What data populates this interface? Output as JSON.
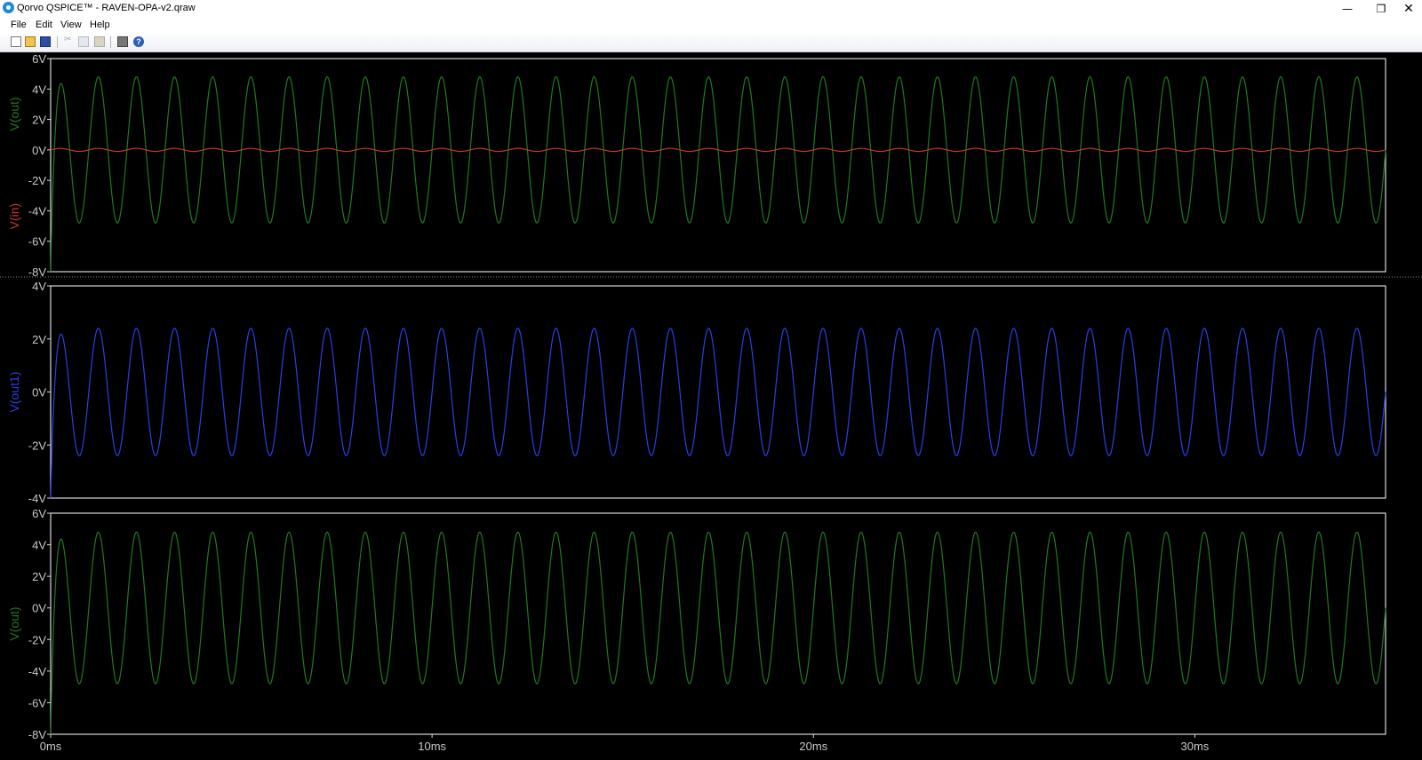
{
  "window": {
    "title": "Qorvo QSPICE™ - RAVEN-OPA-v2.qraw",
    "controls": {
      "minimize": "—",
      "maximize": "❐",
      "close": "✕"
    }
  },
  "menu": {
    "items": [
      "File",
      "Edit",
      "View",
      "Help"
    ]
  },
  "toolbar": {
    "icons": [
      "new-file-icon",
      "open-folder-icon",
      "save-icon",
      "cut-icon",
      "copy-icon",
      "paste-icon",
      "print-icon",
      "help-icon"
    ],
    "help_glyph": "?",
    "cut_glyph": "✂"
  },
  "colors": {
    "background": "#000000",
    "frame": "#d8d8d8",
    "axis_text": "#c8c8c8",
    "v_out": "#1f7a1f",
    "v_in": "#c0392b",
    "v_out1": "#2a3fe6"
  },
  "chart_data": [
    {
      "type": "line",
      "title": "",
      "xlim": [
        0,
        35
      ],
      "ylim": [
        -8,
        6
      ],
      "yticks": [
        "6V",
        "4V",
        "2V",
        "0V",
        "-2V",
        "-4V",
        "-6V",
        "-8V"
      ],
      "ylabels": [
        "V(out)",
        "V(in)"
      ],
      "series": [
        {
          "name": "V(out)",
          "color": "#1f7a1f",
          "amplitude": 4.8,
          "frequency_khz": 1,
          "start_value": -8
        },
        {
          "name": "V(in)",
          "color": "#c0392b",
          "amplitude": 0.1,
          "frequency_khz": 1,
          "start_value": 0
        }
      ]
    },
    {
      "type": "line",
      "title": "",
      "xlim": [
        0,
        35
      ],
      "ylim": [
        -4,
        4
      ],
      "yticks": [
        "4V",
        "2V",
        "0V",
        "-2V",
        "-4V"
      ],
      "ylabels": [
        "V(out1)"
      ],
      "series": [
        {
          "name": "V(out1)",
          "color": "#2a3fe6",
          "amplitude": 2.4,
          "frequency_khz": 1,
          "start_value": -4
        }
      ]
    },
    {
      "type": "line",
      "title": "",
      "xlim": [
        0,
        35
      ],
      "ylim": [
        -8,
        6
      ],
      "yticks": [
        "6V",
        "4V",
        "2V",
        "0V",
        "-2V",
        "-4V",
        "-6V",
        "-8V"
      ],
      "ylabels": [
        "V(out)"
      ],
      "series": [
        {
          "name": "V(out)",
          "color": "#1f7a1f",
          "amplitude": 4.8,
          "frequency_khz": 1,
          "start_value": -8
        }
      ]
    }
  ],
  "x_axis": {
    "ticks": [
      "0ms",
      "10ms",
      "20ms",
      "30ms"
    ],
    "tick_values": [
      0,
      10,
      20,
      30
    ]
  }
}
